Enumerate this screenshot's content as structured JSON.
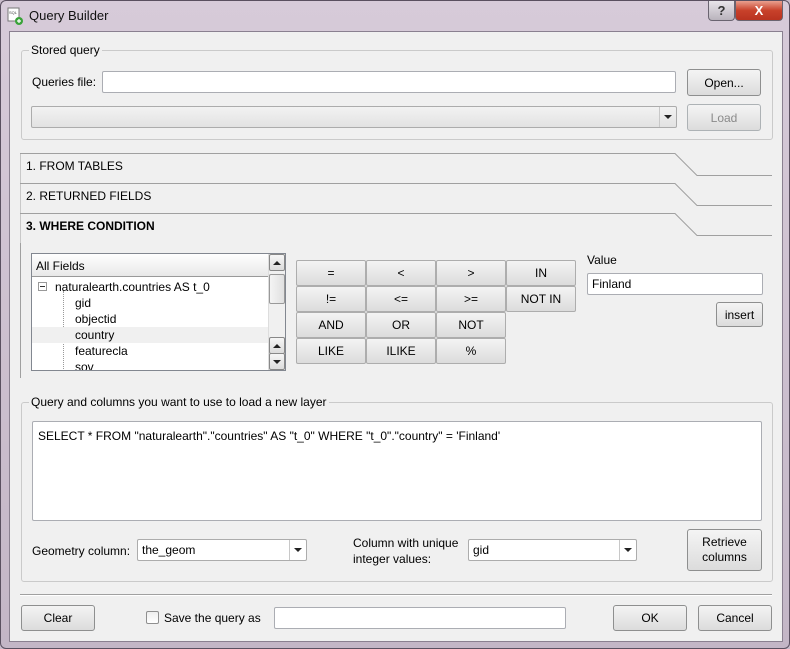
{
  "window": {
    "title": "Query Builder",
    "help_label": "?",
    "close_label": "X"
  },
  "stored_query": {
    "group_label": "Stored query",
    "queries_file_label": "Queries file:",
    "queries_file_value": "",
    "open_button": "Open...",
    "query_select_value": "",
    "load_button": "Load"
  },
  "sections": [
    {
      "label": "1. FROM TABLES",
      "active": false
    },
    {
      "label": "2. RETURNED FIELDS",
      "active": false
    },
    {
      "label": "3. WHERE CONDITION",
      "active": true
    }
  ],
  "fields_tree": {
    "header": "All Fields",
    "root": "naturalearth.countries AS t_0",
    "items": [
      "gid",
      "objectid",
      "country",
      "featurecla",
      "sov"
    ],
    "selected": "country"
  },
  "operators": [
    "=",
    "<",
    ">",
    "IN",
    "!=",
    "<=",
    ">=",
    "NOT IN",
    "AND",
    "OR",
    "NOT",
    "LIKE",
    "ILIKE",
    "%"
  ],
  "value": {
    "label": "Value",
    "input_value": "Finland",
    "insert_button": "insert"
  },
  "query_group": {
    "group_label": "Query and columns you want to use to load a new layer",
    "sql": "SELECT * FROM \"naturalearth\".\"countries\" AS \"t_0\" WHERE \"t_0\".\"country\" = 'Finland'",
    "geometry_label": "Geometry column:",
    "geometry_value": "the_geom",
    "unique_label_1": "Column with unique",
    "unique_label_2": "integer values:",
    "unique_value": "gid",
    "retrieve_1": "Retrieve",
    "retrieve_2": "columns"
  },
  "footer": {
    "clear_button": "Clear",
    "save_checkbox_label": "Save the query as",
    "save_checked": false,
    "save_name_value": "",
    "ok_button": "OK",
    "cancel_button": "Cancel"
  }
}
